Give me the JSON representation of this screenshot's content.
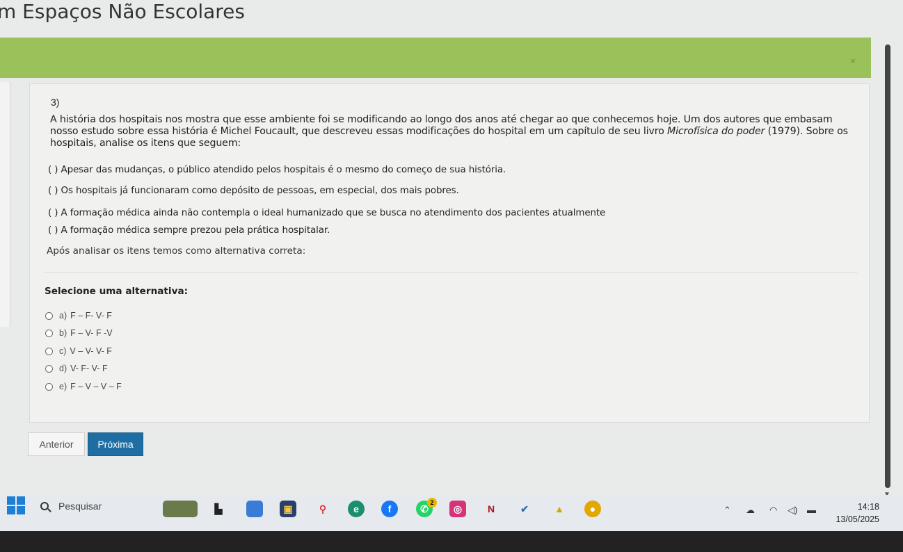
{
  "page": {
    "title": "m Espaços Não Escolares",
    "close_symbol": "×"
  },
  "question": {
    "number": "3)",
    "text_part1": "A história dos hospitais nos mostra que esse ambiente foi se modificando ao longo dos anos até chegar ao que conhecemos hoje. Um dos autores que embasam nosso estudo sobre essa história é Michel Foucault, que descreveu essas modificações do hospital em um capítulo de seu livro ",
    "book_title": "Microfísica do poder",
    "text_part2": " (1979). Sobre os hospitais, analise os itens que seguem:",
    "statements": [
      "(   ) Apesar das mudanças, o público atendido pelos hospitais é o mesmo do começo de sua história.",
      "(   ) Os hospitais já funcionaram como depósito de pessoas, em especial, dos mais pobres.",
      "(   ) A formação médica ainda não contempla o ideal humanizado que se busca no atendimento dos pacientes atualmente",
      "(   ) A formação médica sempre prezou pela prática hospitalar."
    ],
    "after_text": "Após analisar os itens temos como alternativa correta:",
    "select_label": "Selecione uma alternativa:",
    "options": [
      {
        "letter": "a)",
        "text": "F – F- V- F"
      },
      {
        "letter": "b)",
        "text": "F – V- F -V"
      },
      {
        "letter": "c)",
        "text": "V – V- V- F"
      },
      {
        "letter": "d)",
        "text": "V- F- V- F"
      },
      {
        "letter": "e)",
        "text": "F – V – V – F"
      }
    ]
  },
  "navigation": {
    "prev_label": "Anterior",
    "next_label": "Próxima"
  },
  "taskbar": {
    "search_placeholder": "Pesquisar",
    "whatsapp_badge": "2",
    "time": "14:18",
    "date": "13/05/2025"
  },
  "colors": {
    "banner": "#9bc25a",
    "primary_button": "#1f6ea3"
  }
}
